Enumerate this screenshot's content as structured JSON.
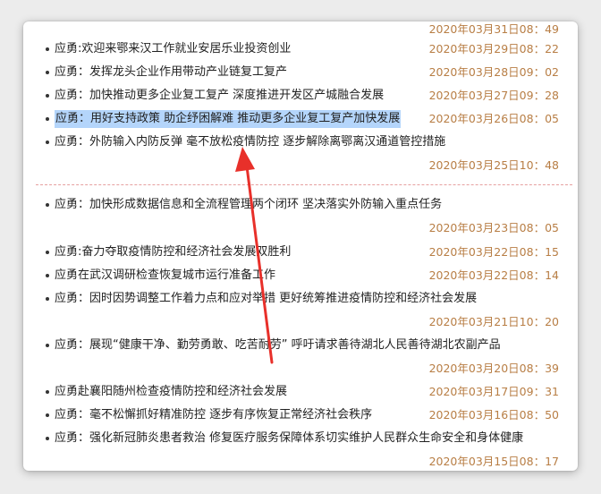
{
  "news": [
    {
      "title": "",
      "date": "2020年03月31日08：49",
      "highlighted": false
    },
    {
      "title": "应勇:欢迎来鄂来汉工作就业安居乐业投资创业",
      "date": "2020年03月29日08：22",
      "highlighted": false
    },
    {
      "title": "应勇：发挥龙头企业作用带动产业链复工复产",
      "date": "2020年03月28日09：02",
      "highlighted": false
    },
    {
      "title": "应勇：加快推动更多企业复工复产 深度推进开发区产城融合发展",
      "date": "2020年03月27日09：28",
      "highlighted": false
    },
    {
      "title": "应勇：用好支持政策 助企纾困解难 推动更多企业复工复产加快发展",
      "date": "2020年03月26日08：05",
      "highlighted": true
    },
    {
      "title": "应勇：外防输入内防反弹 毫不放松疫情防控 逐步解除离鄂离汉通道管控措施",
      "date": "",
      "highlighted": false
    },
    {
      "title": "",
      "date": "2020年03月25日10：48",
      "highlighted": false
    },
    {
      "title": "应勇：加快形成数据信息和全流程管理两个闭环 坚决落实外防输入重点任务",
      "date": "",
      "highlighted": false
    },
    {
      "title": "",
      "date": "2020年03月23日08：05",
      "highlighted": false
    },
    {
      "title": "应勇:奋力夺取疫情防控和经济社会发展双胜利",
      "date": "2020年03月22日08：15",
      "highlighted": false
    },
    {
      "title": "应勇在武汉调研检查恢复城市运行准备工作",
      "date": "2020年03月22日08：14",
      "highlighted": false
    },
    {
      "title": "应勇：因时因势调整工作着力点和应对举措 更好统筹推进疫情防控和经济社会发展",
      "date": "",
      "highlighted": false
    },
    {
      "title": "",
      "date": "2020年03月21日10：20",
      "highlighted": false
    },
    {
      "title": "应勇：展现“健康干净、勤劳勇敢、吃苦耐劳” 呼吁请求善待湖北人民善待湖北农副产品",
      "date": "",
      "highlighted": false
    },
    {
      "title": "",
      "date": "2020年03月20日08：39",
      "highlighted": false
    },
    {
      "title": "应勇赴襄阳随州检查疫情防控和经济社会发展",
      "date": "2020年03月17日09：31",
      "highlighted": false
    },
    {
      "title": "应勇：毫不松懈抓好精准防控 逐步有序恢复正常经济社会秩序",
      "date": "2020年03月16日08：50",
      "highlighted": false
    },
    {
      "title": "应勇：强化新冠肺炎患者救治 修复医疗服务保障体系切实维护人民群众生命安全和身体健康",
      "date": "",
      "highlighted": false
    },
    {
      "title": "",
      "date": "2020年03月15日08：17",
      "highlighted": false
    }
  ],
  "colors": {
    "date": "#b87e45",
    "highlight": "#b4d5fb",
    "arrow": "#e8302a",
    "divider": "#e6a0a0"
  },
  "annotation": {
    "shape": "arrow-icon"
  }
}
